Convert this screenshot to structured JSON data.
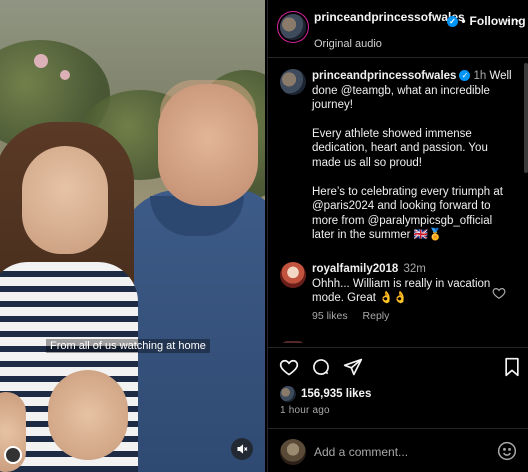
{
  "video": {
    "caption": "From all of us watching at home",
    "audio_icon": "speaker-muted-icon"
  },
  "header": {
    "username": "princeandprincessofwales",
    "follow_label": "Following",
    "audio_label": "Original audio",
    "more_icon": "more-horizontal-icon"
  },
  "post_caption": {
    "username": "princeandprincessofwales",
    "time": "1h",
    "para1": "Well done @teamgb, what an incredible journey!",
    "para2": "Every athlete showed immense dedication, heart and passion. You made us all so proud!",
    "para3": "Here’s to celebrating every triumph at @paris2024 and looking forward to more from @paralympicsgb_official later in the summer 🇬🇧🏅"
  },
  "comments": [
    {
      "username": "royalfamily2018",
      "time": "32m",
      "text": "Ohhh... William is really in vacation mode. Great 👌👌",
      "likes": "95 likes",
      "reply_label": "Reply"
    }
  ],
  "actions": {
    "likes_count": "156,935 likes",
    "posted_ago": "1 hour ago",
    "icons": [
      "heart-icon",
      "comment-icon",
      "share-icon",
      "bookmark-icon"
    ]
  },
  "add_comment": {
    "placeholder": "Add a comment...",
    "emoji_icon": "emoji-icon"
  },
  "colors": {
    "background": "#000000",
    "verified": "#0095f6",
    "secondary_text": "#a8a8a8",
    "divider": "#262626"
  }
}
